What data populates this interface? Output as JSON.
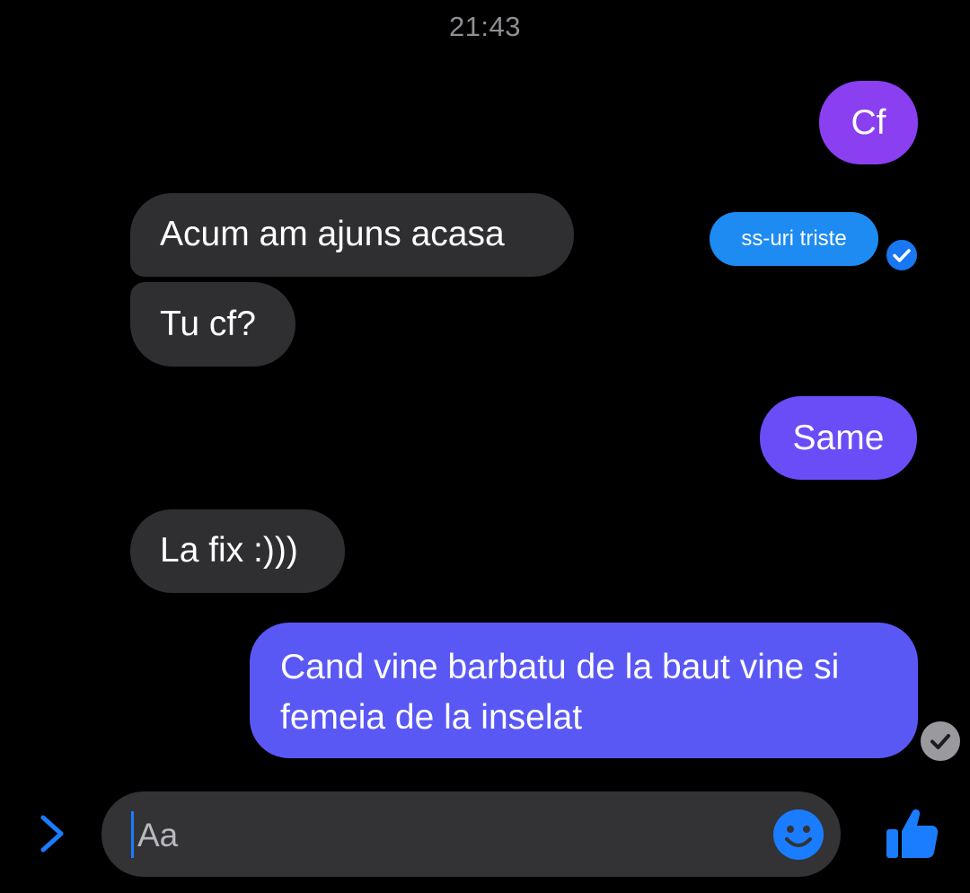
{
  "header": {
    "time": "21:43"
  },
  "messages": [
    {
      "id": "cf",
      "direction": "outgoing",
      "text": "Cf"
    },
    {
      "id": "acum",
      "direction": "incoming",
      "text": "Acum am ajuns acasa"
    },
    {
      "id": "story",
      "direction": "outgoing",
      "text": "ss-uri triste"
    },
    {
      "id": "tucf",
      "direction": "incoming",
      "text": "Tu cf?"
    },
    {
      "id": "same",
      "direction": "outgoing",
      "text": "Same"
    },
    {
      "id": "lafix",
      "direction": "incoming",
      "text": "La fix :)))"
    },
    {
      "id": "cand",
      "direction": "outgoing",
      "text": "Cand vine barbatu de la baut vine si femeia de la inselat"
    }
  ],
  "composer": {
    "placeholder": "Aa",
    "icons": [
      "chevron-right-icon",
      "emoji-icon",
      "thumbs-up-icon"
    ]
  },
  "colors": {
    "background": "#000000",
    "incoming_bubble": "#2f2f31",
    "outgoing_purple": "#8a3ff0",
    "outgoing_violet": "#6b4df8",
    "outgoing_blue": "#5a58f5",
    "accent_blue": "#1877f2"
  }
}
